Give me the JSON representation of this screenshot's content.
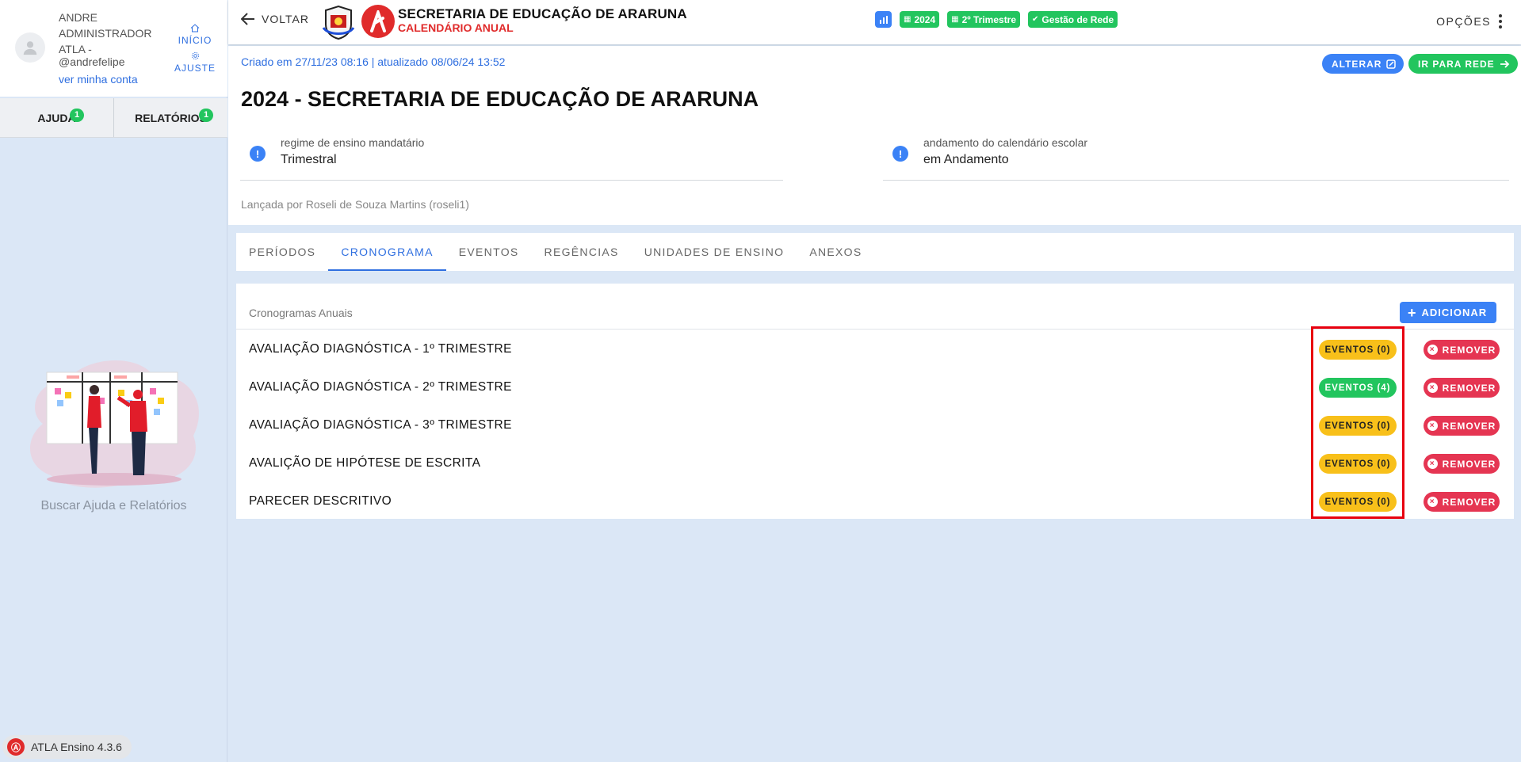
{
  "user": {
    "name": "ANDRE ADMINISTRADOR ATLA -",
    "handle": "@andrefelipe",
    "account_link": "ver minha conta"
  },
  "sidebar": {
    "links": [
      {
        "label": "INÍCIO",
        "icon": "home-icon"
      },
      {
        "label": "AJUSTE",
        "icon": "gear-icon"
      }
    ],
    "help_tabs": [
      {
        "label": "AJUDA",
        "count": "1"
      },
      {
        "label": "RELATÓRIOS",
        "count": "1"
      }
    ],
    "help_caption": "Buscar Ajuda e Relatórios",
    "version": "ATLA Ensino 4.3.6"
  },
  "header": {
    "back_label": "VOLTAR",
    "title": "SECRETARIA DE EDUCAÇÃO DE ARARUNA",
    "subtitle": "CALENDÁRIO ANUAL",
    "chips": [
      {
        "label": "2024",
        "icon": "calendar-icon"
      },
      {
        "label": "2º Trimestre",
        "icon": "calendar-icon"
      },
      {
        "label": "Gestão de Rede",
        "icon": "check-circle-icon"
      }
    ],
    "options_label": "OPÇÕES"
  },
  "info": {
    "meta": "Criado em 27/11/23 08:16 | atualizado 08/06/24 13:52",
    "alter_label": "ALTERAR",
    "rede_label": "IR PARA REDE",
    "page_title": "2024 - SECRETARIA DE EDUCAÇÃO DE ARARUNA",
    "fields": [
      {
        "label": "regime de ensino mandatário",
        "value": "Trimestral"
      },
      {
        "label": "andamento do calendário escolar",
        "value": "em Andamento"
      }
    ],
    "posted_by": "Lançada por Roseli de Souza Martins (roseli1)"
  },
  "tabs": [
    {
      "label": "PERÍODOS",
      "active": false
    },
    {
      "label": "CRONOGRAMA",
      "active": true
    },
    {
      "label": "EVENTOS",
      "active": false
    },
    {
      "label": "REGÊNCIAS",
      "active": false
    },
    {
      "label": "UNIDADES DE ENSINO",
      "active": false
    },
    {
      "label": "ANEXOS",
      "active": false
    }
  ],
  "schedules": {
    "title": "Cronogramas Anuais",
    "add_label": "ADICIONAR",
    "remove_label": "REMOVER",
    "rows": [
      {
        "label": "AVALIAÇÃO DIAGNÓSTICA - 1º TRIMESTRE",
        "events": "EVENTOS (0)"
      },
      {
        "label": "AVALIAÇÃO DIAGNÓSTICA - 2º TRIMESTRE",
        "events": "EVENTOS (4)"
      },
      {
        "label": "AVALIAÇÃO DIAGNÓSTICA - 3º TRIMESTRE",
        "events": "EVENTOS (0)"
      },
      {
        "label": "AVALIÇÃO DE HIPÓTESE DE ESCRITA",
        "events": "EVENTOS (0)"
      },
      {
        "label": "PARECER DESCRITIVO",
        "events": "EVENTOS (0)"
      }
    ]
  },
  "colors": {
    "accent": "#2f6fe0",
    "success": "#22c55e",
    "warning": "#f8c01a",
    "danger": "#e53552",
    "brand_red": "#e02b2b",
    "highlight": "#e8000f"
  }
}
